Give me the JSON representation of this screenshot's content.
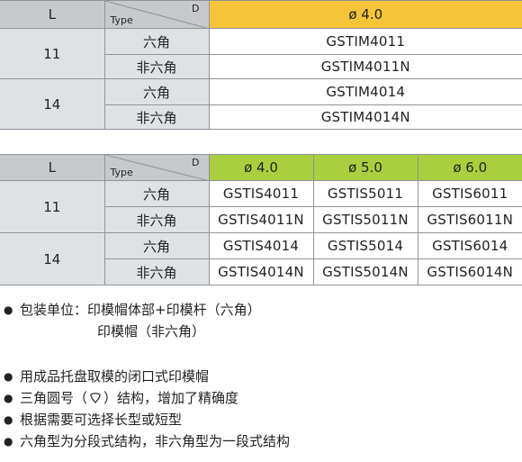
{
  "table1": {
    "header": {
      "l": "L",
      "type": "Type",
      "d": "D",
      "dia": "ø 4.0"
    },
    "groups": [
      {
        "l": "11",
        "rows": [
          {
            "type": "六角",
            "code": "GSTIM4011"
          },
          {
            "type": "非六角",
            "code": "GSTIM4011N"
          }
        ]
      },
      {
        "l": "14",
        "rows": [
          {
            "type": "六角",
            "code": "GSTIM4014"
          },
          {
            "type": "非六角",
            "code": "GSTIM4014N"
          }
        ]
      }
    ]
  },
  "table2": {
    "header": {
      "l": "L",
      "type": "Type",
      "d": "D",
      "dias": [
        "ø 4.0",
        "ø 5.0",
        "ø 6.0"
      ]
    },
    "groups": [
      {
        "l": "11",
        "rows": [
          {
            "type": "六角",
            "codes": [
              "GSTIS4011",
              "GSTIS5011",
              "GSTIS6011"
            ]
          },
          {
            "type": "非六角",
            "codes": [
              "GSTIS4011N",
              "GSTIS5011N",
              "GSTIS6011N"
            ]
          }
        ]
      },
      {
        "l": "14",
        "rows": [
          {
            "type": "六角",
            "codes": [
              "GSTIS4014",
              "GSTIS5014",
              "GSTIS6014"
            ]
          },
          {
            "type": "非六角",
            "codes": [
              "GSTIS4014N",
              "GSTIS5014N",
              "GSTIS6014N"
            ]
          }
        ]
      }
    ]
  },
  "notes": {
    "bullet": "●",
    "packaging_line1": "包装单位：印模帽体部+印模杆（六角）",
    "packaging_line2": "印模帽（非六角）",
    "item1": "用成品托盘取模的闭口式印模帽",
    "item2_before": "三角圆号（",
    "item2_after": "）结构，增加了精确度",
    "item3": "根据需要可选择长型或短型",
    "item4": "六角型为分段式结构，非六角型为一段式结构"
  },
  "colors": {
    "yellow_header": "#f5c43a",
    "green_header": "#a9cf3f",
    "grey_header": "#c6cacd",
    "grey_cell": "#dfe2e5"
  },
  "icons": {
    "rounded_triangle": "triangle-round-icon",
    "bullet": "bullet-icon"
  }
}
